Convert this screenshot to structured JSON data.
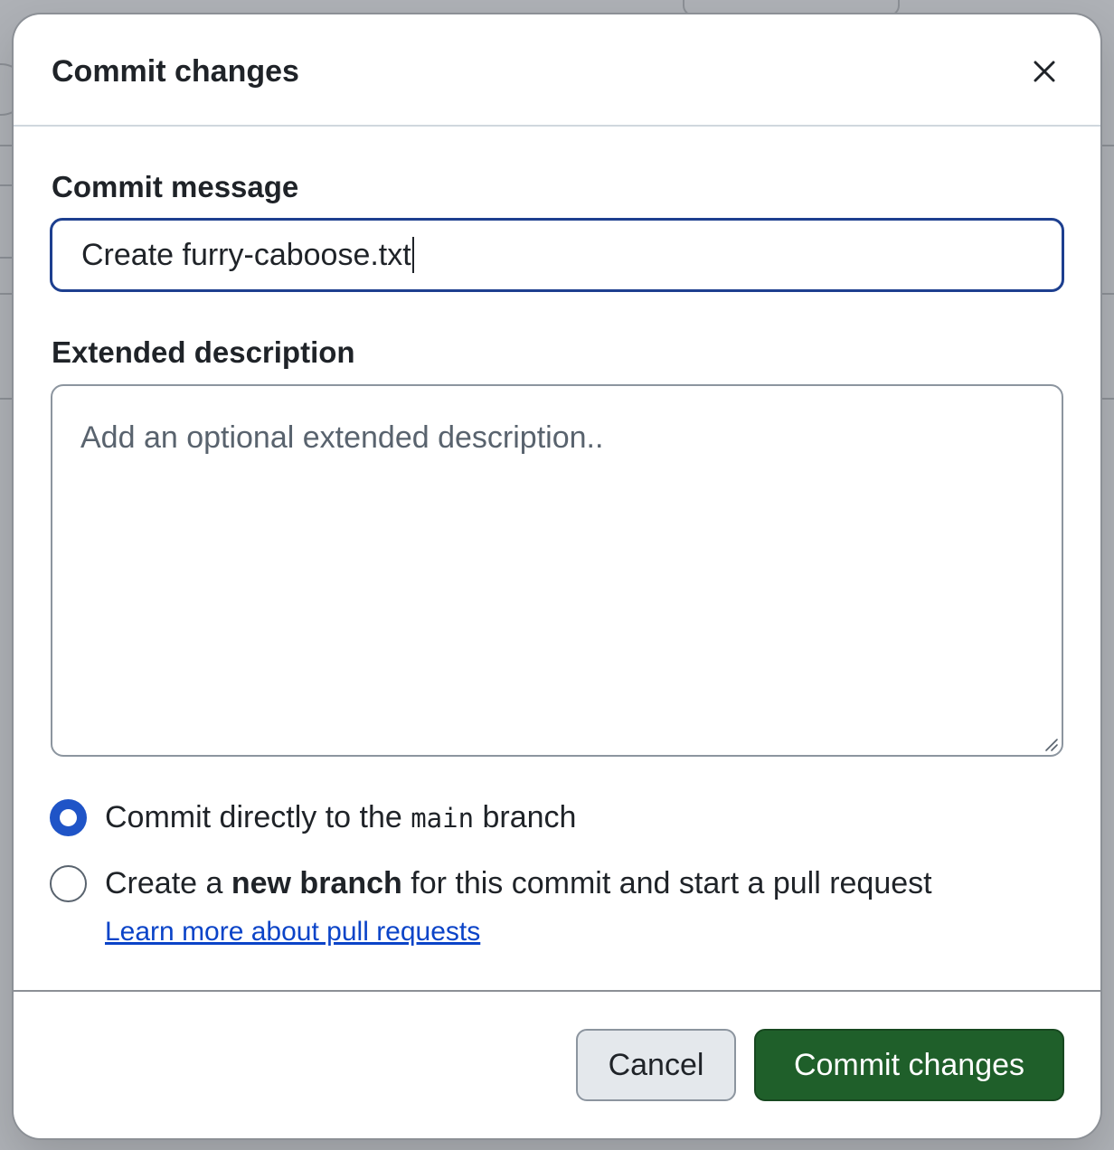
{
  "dialog": {
    "title": "Commit changes",
    "close_icon": "close-icon"
  },
  "commit_message": {
    "label": "Commit message",
    "value": "Create furry-caboose.txt"
  },
  "extended_description": {
    "label": "Extended description",
    "placeholder": "Add an optional extended description.."
  },
  "options": {
    "direct": {
      "text_before": "Commit directly to the ",
      "branch_name": "main",
      "text_after": " branch",
      "selected": true
    },
    "new_branch": {
      "text_before": "Create a ",
      "bold_text": "new branch",
      "text_after": " for this commit and start a pull request",
      "selected": false
    },
    "learn_more_link": "Learn more about pull requests"
  },
  "buttons": {
    "cancel": "Cancel",
    "commit": "Commit changes"
  },
  "colors": {
    "primary_button": "#1f5f2a",
    "focus_border": "#1d3f8f",
    "radio_selected": "#1f54c7",
    "link": "#0b44c8"
  }
}
